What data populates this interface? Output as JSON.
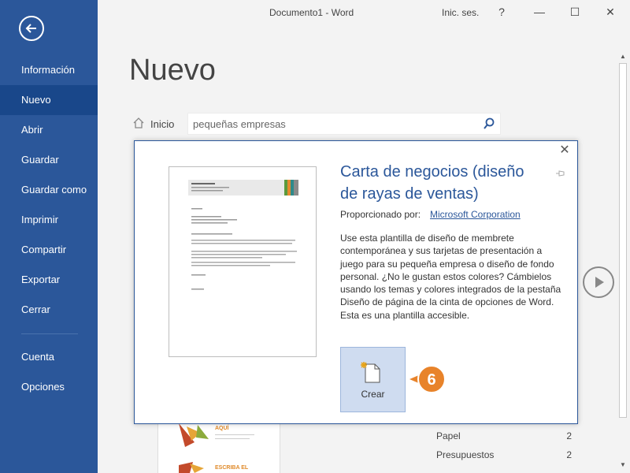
{
  "titlebar": {
    "title": "Documento1  -  Word",
    "signin": "Inic. ses.",
    "help": "?",
    "minimize": "—",
    "maximize": "☐",
    "close": "✕"
  },
  "sidebar": {
    "back_icon": "back-arrow-icon",
    "items": [
      {
        "label": "Información"
      },
      {
        "label": "Nuevo",
        "active": true
      },
      {
        "label": "Abrir"
      },
      {
        "label": "Guardar"
      },
      {
        "label": "Guardar como"
      },
      {
        "label": "Imprimir"
      },
      {
        "label": "Compartir"
      },
      {
        "label": "Exportar"
      },
      {
        "label": "Cerrar"
      },
      {
        "label": "Cuenta"
      },
      {
        "label": "Opciones"
      }
    ]
  },
  "main": {
    "page_title": "Nuevo",
    "home_label": "Inicio",
    "search_value": "pequeñas empresas",
    "categories": [
      {
        "name": "Papel",
        "count": "2"
      },
      {
        "name": "Presupuestos",
        "count": "2"
      }
    ],
    "thumb_texts": [
      "AQUÍ",
      "ESCRIBA EL"
    ]
  },
  "modal": {
    "title": "Carta de negocios (diseño de rayas de ventas)",
    "provider_label": "Proporcionado por:",
    "provider_link": "Microsoft Corporation",
    "description": "Use esta plantilla de diseño de membrete contemporánea y sus tarjetas de presentación a juego para su pequeña empresa o diseño de fondo personal. ¿No le gustan estos colores? Cámbielos usando los temas y colores integrados de la pestaña Diseño de página de la cinta de opciones de Word. Esta es una plantilla accesible.",
    "create_label": "Crear",
    "close": "✕"
  },
  "callout": {
    "number": "6"
  },
  "colors": {
    "brand": "#2b579a",
    "active_nav": "#19478a",
    "callout": "#e8832a",
    "create_bg": "#cfdcf0"
  }
}
